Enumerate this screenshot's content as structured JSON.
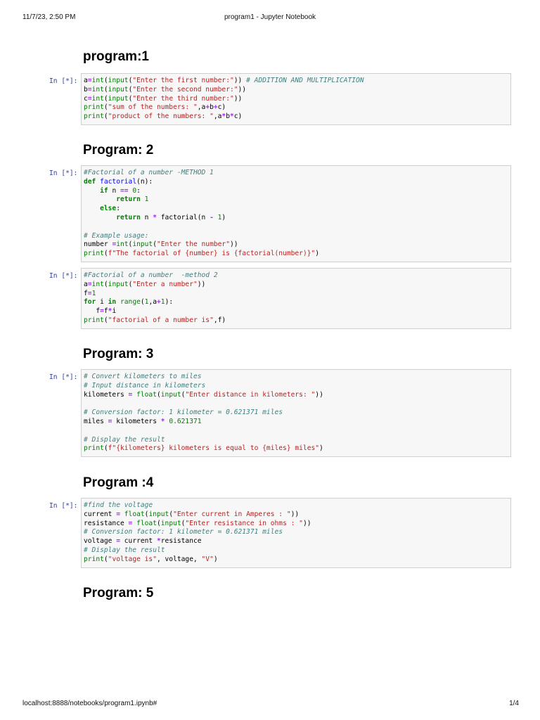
{
  "header": {
    "datetime": "11/7/23, 2:50 PM",
    "page_title": "program1 - Jupyter Notebook"
  },
  "footer": {
    "url": "localhost:8888/notebooks/program1.ipynb#",
    "page_number": "1/4"
  },
  "headings": {
    "p1": "program:1",
    "p2": "Program: 2",
    "p3": "Program: 3",
    "p4": "Program :4",
    "p5": "Program: 5"
  },
  "cells": [
    {
      "prompt": "In [*]:",
      "lines": [
        "a=int(input(\"Enter the first number:\")) # ADDITION AND MULTIPLICATION",
        "b=int(input(\"Enter the second number:\"))",
        "c=int(input(\"Enter the third number:\"))",
        "print(\"sum of the numbers: \",a+b+c)",
        "print(\"product of the numbers: \",a*b*c)"
      ]
    },
    {
      "prompt": "In [*]:",
      "lines": [
        "#Factorial of a number -METHOD 1",
        "def factorial(n):",
        "    if n == 0:",
        "        return 1",
        "    else:",
        "        return n * factorial(n - 1)",
        "",
        "# Example usage:",
        "number =int(input(\"Enter the number\"))",
        "print(f\"The factorial of {number} is {factorial(number)}\")"
      ]
    },
    {
      "prompt": "In [*]:",
      "lines": [
        "#Factorial of a number  -method 2",
        "a=int(input(\"Enter a number\"))",
        "f=1",
        "for i in range(1,a+1):",
        "   f=f*i",
        "print(\"factorial of a number is\",f)"
      ]
    },
    {
      "prompt": "In [*]:",
      "lines": [
        "# Convert kilometers to miles",
        "# Input distance in kilometers",
        "kilometers = float(input(\"Enter distance in kilometers: \"))",
        "",
        "# Conversion factor: 1 kilometer = 0.621371 miles",
        "miles = kilometers * 0.621371",
        "",
        "# Display the result",
        "print(f\"{kilometers} kilometers is equal to {miles} miles\")"
      ]
    },
    {
      "prompt": "In [*]:",
      "lines": [
        "#find the voltage",
        "current = float(input(\"Enter current in Amperes : \"))",
        "resistance = float(input(\"Enter resistance in ohms : \"))",
        "# Conversion factor: 1 kilometer = 0.621371 miles",
        "voltage = current *resistance",
        "# Display the result",
        "print(\"voltage is\", voltage, \"V\")"
      ]
    }
  ]
}
